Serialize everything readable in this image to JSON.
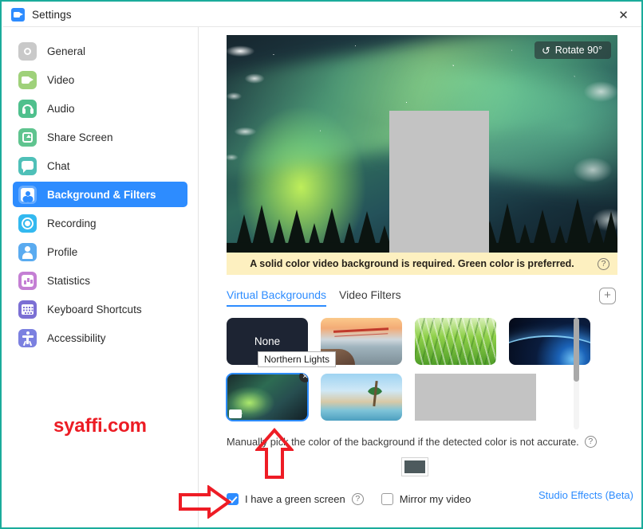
{
  "window": {
    "title": "Settings",
    "app_icon": "zoom-video-icon",
    "close_label": "✕",
    "border_color": "#1aab9b"
  },
  "sidebar": {
    "items": [
      {
        "label": "General",
        "icon": "gear-icon",
        "icon_class": "ico-gear",
        "active": false
      },
      {
        "label": "Video",
        "icon": "video-camera-icon",
        "icon_class": "ico-video",
        "active": false
      },
      {
        "label": "Audio",
        "icon": "headphones-icon",
        "icon_class": "ico-audio",
        "active": false
      },
      {
        "label": "Share Screen",
        "icon": "share-screen-icon",
        "icon_class": "ico-share",
        "active": false
      },
      {
        "label": "Chat",
        "icon": "chat-bubble-icon",
        "icon_class": "ico-chat",
        "active": false
      },
      {
        "label": "Background & Filters",
        "icon": "person-frame-icon",
        "icon_class": "ico-bgf",
        "active": true
      },
      {
        "label": "Recording",
        "icon": "record-circle-icon",
        "icon_class": "ico-record",
        "active": false
      },
      {
        "label": "Profile",
        "icon": "user-profile-icon",
        "icon_class": "ico-profile",
        "active": false
      },
      {
        "label": "Statistics",
        "icon": "bar-chart-icon",
        "icon_class": "ico-stats",
        "active": false
      },
      {
        "label": "Keyboard Shortcuts",
        "icon": "keyboard-icon",
        "icon_class": "ico-keys",
        "active": false
      },
      {
        "label": "Accessibility",
        "icon": "accessibility-person-icon",
        "icon_class": "ico-access",
        "active": false
      }
    ],
    "watermark": "syaffi.com",
    "watermark_color": "#ec1c24",
    "active_color": "#2d8cff"
  },
  "preview": {
    "rotate_button": "Rotate 90°",
    "rotate_icon": "rotate-ccw-icon",
    "background_name": "Northern Lights",
    "redacted": true
  },
  "notice": {
    "text": "A solid color video background is required. Green color is preferred.",
    "help_icon": "question-mark-icon",
    "background_color": "#fdf0c0"
  },
  "tabs": {
    "items": [
      {
        "label": "Virtual Backgrounds",
        "active": true
      },
      {
        "label": "Video Filters",
        "active": false
      }
    ],
    "add_button_icon": "plus-icon",
    "add_button_label": "+"
  },
  "backgrounds": {
    "rows": [
      [
        {
          "label": "None",
          "kind": "none",
          "selected": false
        },
        {
          "label": "Golden Gate Bridge",
          "kind": "thumb-bridge",
          "selected": false
        },
        {
          "label": "Grass",
          "kind": "thumb-grass",
          "selected": false
        },
        {
          "label": "Earth from Space",
          "kind": "thumb-earth",
          "selected": false
        }
      ],
      [
        {
          "label": "Northern Lights",
          "kind": "thumb-aurora",
          "selected": true,
          "close_label": "✕",
          "badge_icon": "video-camera-icon"
        },
        {
          "label": "Beach Palm",
          "kind": "thumb-beach",
          "selected": false
        },
        {
          "label": "Redacted",
          "kind": "redacted",
          "selected": false
        }
      ]
    ],
    "tooltip": "Northern Lights",
    "scrollbar": "vertical-scrollbar"
  },
  "manual": {
    "text": "Manually pick the color of the background if the detected color is not accurate.",
    "help_icon": "question-mark-icon",
    "swatch_color": "#4d5a5d",
    "swatch_name": "color-picker-swatch"
  },
  "bottom": {
    "green_screen": {
      "label": "I have a green screen",
      "checked": true,
      "help_icon": "question-mark-icon"
    },
    "mirror_video": {
      "label": "Mirror my video",
      "checked": false
    },
    "studio_effects": {
      "label": "Studio Effects (Beta)",
      "color": "#2d8cff"
    }
  },
  "annotations": {
    "color": "#ee1c25",
    "arrow_up": "red-up-arrow-annotation",
    "arrow_right": "red-right-arrow-annotation"
  }
}
